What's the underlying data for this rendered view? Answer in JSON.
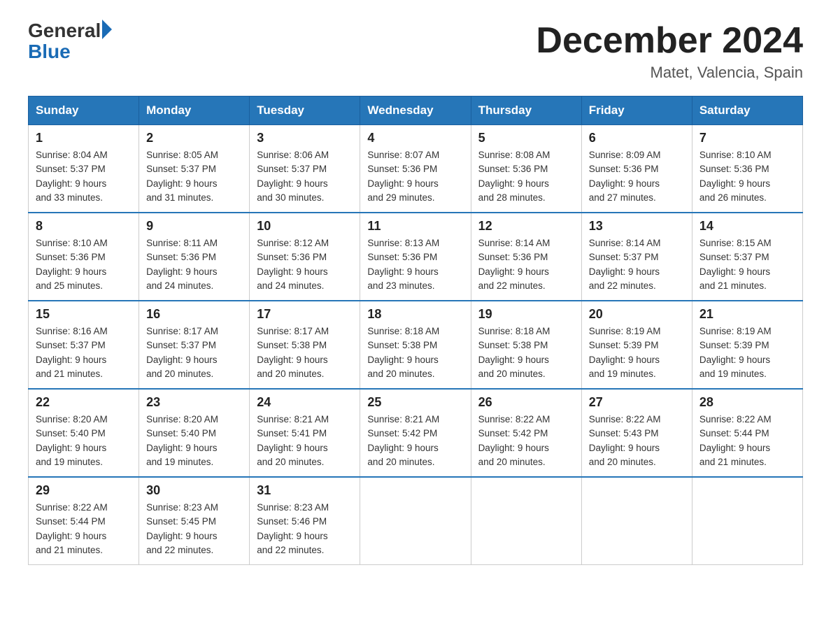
{
  "logo": {
    "general": "General",
    "blue": "Blue"
  },
  "title": {
    "month": "December 2024",
    "location": "Matet, Valencia, Spain"
  },
  "days_of_week": [
    "Sunday",
    "Monday",
    "Tuesday",
    "Wednesday",
    "Thursday",
    "Friday",
    "Saturday"
  ],
  "weeks": [
    [
      {
        "day": "1",
        "sunrise": "8:04 AM",
        "sunset": "5:37 PM",
        "daylight": "9 hours and 33 minutes."
      },
      {
        "day": "2",
        "sunrise": "8:05 AM",
        "sunset": "5:37 PM",
        "daylight": "9 hours and 31 minutes."
      },
      {
        "day": "3",
        "sunrise": "8:06 AM",
        "sunset": "5:37 PM",
        "daylight": "9 hours and 30 minutes."
      },
      {
        "day": "4",
        "sunrise": "8:07 AM",
        "sunset": "5:36 PM",
        "daylight": "9 hours and 29 minutes."
      },
      {
        "day": "5",
        "sunrise": "8:08 AM",
        "sunset": "5:36 PM",
        "daylight": "9 hours and 28 minutes."
      },
      {
        "day": "6",
        "sunrise": "8:09 AM",
        "sunset": "5:36 PM",
        "daylight": "9 hours and 27 minutes."
      },
      {
        "day": "7",
        "sunrise": "8:10 AM",
        "sunset": "5:36 PM",
        "daylight": "9 hours and 26 minutes."
      }
    ],
    [
      {
        "day": "8",
        "sunrise": "8:10 AM",
        "sunset": "5:36 PM",
        "daylight": "9 hours and 25 minutes."
      },
      {
        "day": "9",
        "sunrise": "8:11 AM",
        "sunset": "5:36 PM",
        "daylight": "9 hours and 24 minutes."
      },
      {
        "day": "10",
        "sunrise": "8:12 AM",
        "sunset": "5:36 PM",
        "daylight": "9 hours and 24 minutes."
      },
      {
        "day": "11",
        "sunrise": "8:13 AM",
        "sunset": "5:36 PM",
        "daylight": "9 hours and 23 minutes."
      },
      {
        "day": "12",
        "sunrise": "8:14 AM",
        "sunset": "5:36 PM",
        "daylight": "9 hours and 22 minutes."
      },
      {
        "day": "13",
        "sunrise": "8:14 AM",
        "sunset": "5:37 PM",
        "daylight": "9 hours and 22 minutes."
      },
      {
        "day": "14",
        "sunrise": "8:15 AM",
        "sunset": "5:37 PM",
        "daylight": "9 hours and 21 minutes."
      }
    ],
    [
      {
        "day": "15",
        "sunrise": "8:16 AM",
        "sunset": "5:37 PM",
        "daylight": "9 hours and 21 minutes."
      },
      {
        "day": "16",
        "sunrise": "8:17 AM",
        "sunset": "5:37 PM",
        "daylight": "9 hours and 20 minutes."
      },
      {
        "day": "17",
        "sunrise": "8:17 AM",
        "sunset": "5:38 PM",
        "daylight": "9 hours and 20 minutes."
      },
      {
        "day": "18",
        "sunrise": "8:18 AM",
        "sunset": "5:38 PM",
        "daylight": "9 hours and 20 minutes."
      },
      {
        "day": "19",
        "sunrise": "8:18 AM",
        "sunset": "5:38 PM",
        "daylight": "9 hours and 20 minutes."
      },
      {
        "day": "20",
        "sunrise": "8:19 AM",
        "sunset": "5:39 PM",
        "daylight": "9 hours and 19 minutes."
      },
      {
        "day": "21",
        "sunrise": "8:19 AM",
        "sunset": "5:39 PM",
        "daylight": "9 hours and 19 minutes."
      }
    ],
    [
      {
        "day": "22",
        "sunrise": "8:20 AM",
        "sunset": "5:40 PM",
        "daylight": "9 hours and 19 minutes."
      },
      {
        "day": "23",
        "sunrise": "8:20 AM",
        "sunset": "5:40 PM",
        "daylight": "9 hours and 19 minutes."
      },
      {
        "day": "24",
        "sunrise": "8:21 AM",
        "sunset": "5:41 PM",
        "daylight": "9 hours and 20 minutes."
      },
      {
        "day": "25",
        "sunrise": "8:21 AM",
        "sunset": "5:42 PM",
        "daylight": "9 hours and 20 minutes."
      },
      {
        "day": "26",
        "sunrise": "8:22 AM",
        "sunset": "5:42 PM",
        "daylight": "9 hours and 20 minutes."
      },
      {
        "day": "27",
        "sunrise": "8:22 AM",
        "sunset": "5:43 PM",
        "daylight": "9 hours and 20 minutes."
      },
      {
        "day": "28",
        "sunrise": "8:22 AM",
        "sunset": "5:44 PM",
        "daylight": "9 hours and 21 minutes."
      }
    ],
    [
      {
        "day": "29",
        "sunrise": "8:22 AM",
        "sunset": "5:44 PM",
        "daylight": "9 hours and 21 minutes."
      },
      {
        "day": "30",
        "sunrise": "8:23 AM",
        "sunset": "5:45 PM",
        "daylight": "9 hours and 22 minutes."
      },
      {
        "day": "31",
        "sunrise": "8:23 AM",
        "sunset": "5:46 PM",
        "daylight": "9 hours and 22 minutes."
      },
      null,
      null,
      null,
      null
    ]
  ]
}
